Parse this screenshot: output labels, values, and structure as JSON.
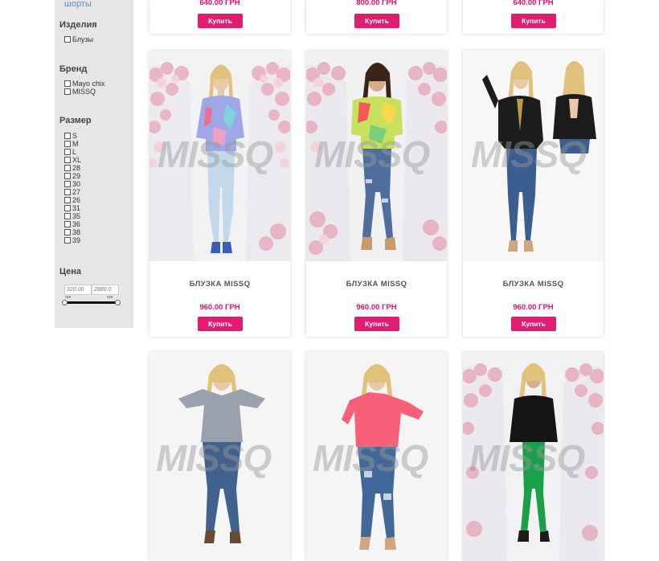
{
  "sidebar": {
    "link_text": "шорты",
    "sections": {
      "izdeliya": {
        "title": "Изделия",
        "options": [
          "Блузы"
        ]
      },
      "brand": {
        "title": "Бренд",
        "options": [
          "Mayo chix",
          "MISSQ"
        ]
      },
      "size": {
        "title": "Размер",
        "options": [
          "S",
          "M",
          "L",
          "XL",
          "28",
          "29",
          "30",
          "27",
          "26",
          "31",
          "35",
          "36",
          "38",
          "39"
        ]
      },
      "price": {
        "title": "Цена",
        "min_value": "320.00",
        "max_value": "2880.0",
        "min_label": "грн",
        "max_label": "грн"
      }
    }
  },
  "top_cards": [
    {
      "price": "640.00 ГРН",
      "buy_label": "Купить"
    },
    {
      "price": "800.00 ГРН",
      "buy_label": "Купить"
    },
    {
      "price": "640.00 ГРН",
      "buy_label": "Купить"
    }
  ],
  "cards": [
    {
      "name": "БЛУЗКА MISSQ",
      "price": "960.00 ГРН",
      "buy_label": "Купить",
      "watermark": "MISSQ"
    },
    {
      "name": "БЛУЗКА MISSQ",
      "price": "960.00 ГРН",
      "buy_label": "Купить",
      "watermark": "MISSQ"
    },
    {
      "name": "БЛУЗКА MISSQ",
      "price": "960.00 ГРН",
      "buy_label": "Купить",
      "watermark": "MISSQ"
    }
  ],
  "bottom_cards": [
    {
      "watermark": "MISSQ"
    },
    {
      "watermark": "MISSQ"
    },
    {
      "watermark": "MISSQ"
    }
  ],
  "colors": {
    "accent": "#e11d72",
    "price": "#e2106c",
    "sidebar_bg": "#e6e6e6",
    "link": "#5b8fd0"
  }
}
